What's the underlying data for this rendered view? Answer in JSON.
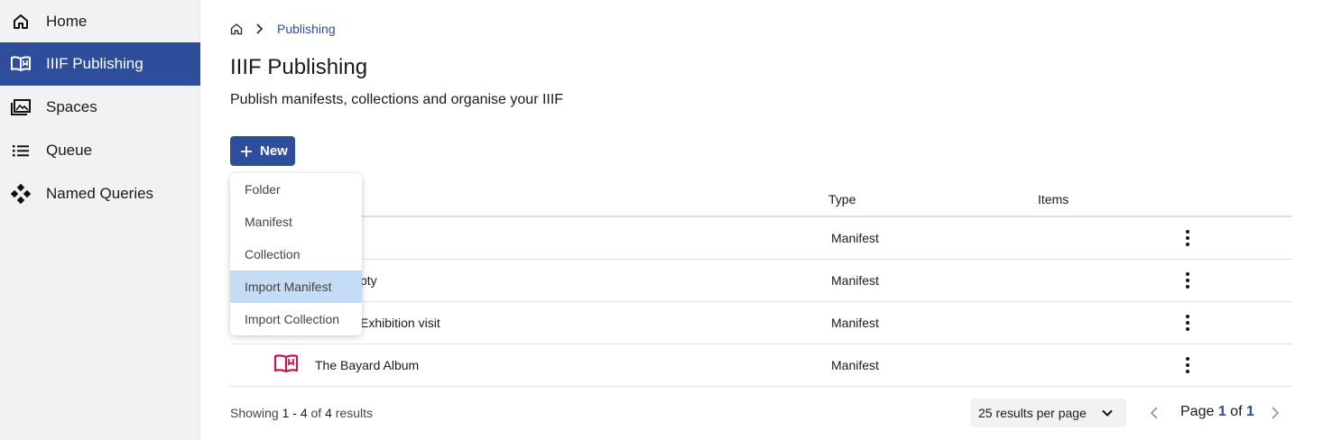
{
  "sidebar": {
    "items": [
      {
        "label": "Home",
        "icon": "home-icon"
      },
      {
        "label": "IIIF Publishing",
        "icon": "open-book-icon",
        "active": true
      },
      {
        "label": "Spaces",
        "icon": "images-icon"
      },
      {
        "label": "Queue",
        "icon": "list-icon"
      },
      {
        "label": "Named Queries",
        "icon": "diamond-nodes-icon"
      }
    ]
  },
  "breadcrumb": {
    "current": "Publishing"
  },
  "page": {
    "title": "IIIF Publishing",
    "subtitle": "Publish manifests, collections and organise your IIIF"
  },
  "toolbar": {
    "new_label": "New"
  },
  "new_menu": {
    "items": [
      "Folder",
      "Manifest",
      "Collection",
      "Import Manifest",
      "Import Collection"
    ],
    "highlighted": "Import Manifest"
  },
  "table": {
    "columns": [
      "Type",
      "Items"
    ],
    "rows": [
      {
        "title": "",
        "type": "Manifest",
        "items": ""
      },
      {
        "title": "pty",
        "type": "Manifest",
        "items": ""
      },
      {
        "title": "Exhibition visit",
        "type": "Manifest",
        "items": ""
      },
      {
        "title": "The Bayard Album",
        "type": "Manifest",
        "items": ""
      }
    ]
  },
  "footer": {
    "showing_prefix": "Showing ",
    "range": "1 - 4",
    "of_text": " of ",
    "total": "4",
    "suffix": " results",
    "per_page": "25 results per page",
    "page_prefix": "Page ",
    "page": "1",
    "page_of": " of ",
    "page_total": "1"
  },
  "colors": {
    "accent": "#2e4d9a",
    "manifest_icon": "#c2185b",
    "menu_highlight": "#c5dcf6"
  }
}
